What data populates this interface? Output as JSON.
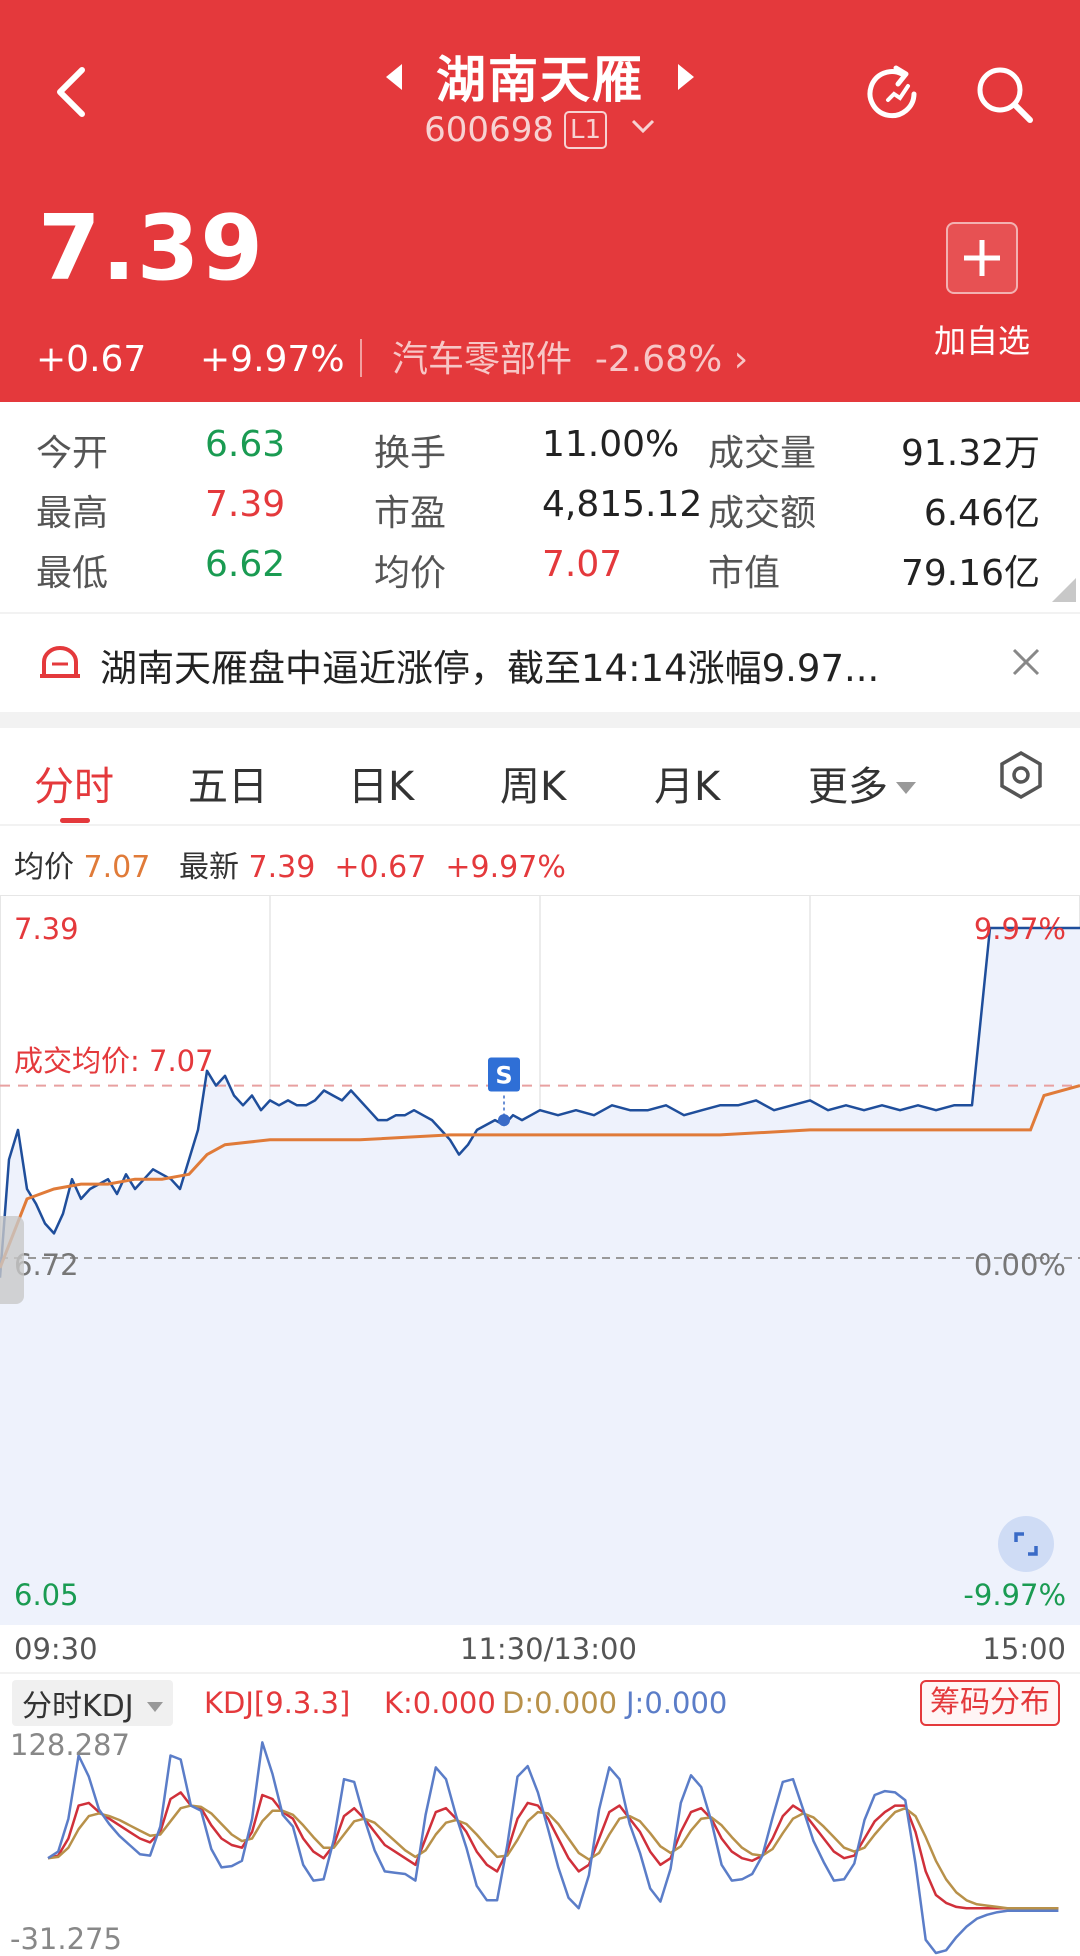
{
  "header": {
    "title": "湖南天雁",
    "code": "600698",
    "level_badge": "L1",
    "price": "7.39",
    "change": "+0.67",
    "change_pct": "+9.97%",
    "sector_name": "汽车零部件",
    "sector_pct": "-2.68%",
    "add_watchlist_label": "加自选",
    "bg_color": "#e4393c"
  },
  "stats": [
    {
      "label": "今开",
      "value": "6.63",
      "color": "green"
    },
    {
      "label": "换手",
      "value": "11.00%",
      "color": "dark"
    },
    {
      "label": "成交量",
      "value": "91.32万",
      "color": "dark"
    },
    {
      "label": "最高",
      "value": "7.39",
      "color": "red"
    },
    {
      "label": "市盈",
      "value": "4,815.12",
      "color": "dark"
    },
    {
      "label": "成交额",
      "value": "6.46亿",
      "color": "dark"
    },
    {
      "label": "最低",
      "value": "6.62",
      "color": "green"
    },
    {
      "label": "均价",
      "value": "7.07",
      "color": "red"
    },
    {
      "label": "市值",
      "value": "79.16亿",
      "color": "dark"
    }
  ],
  "notice": {
    "text": "湖南天雁盘中逼近涨停，截至14:14涨幅9.97..."
  },
  "tabs": {
    "items": [
      "分时",
      "五日",
      "日K",
      "周K",
      "月K",
      "更多"
    ],
    "active": "分时"
  },
  "info_row": {
    "avg_label": "均价",
    "avg_value": "7.07",
    "latest_label": "最新",
    "latest_value": "7.39",
    "change": "+0.67",
    "change_pct": "+9.97%"
  },
  "chart_data": {
    "type": "line",
    "title": "",
    "y_left_ticks": [
      "7.39",
      "6.72",
      "6.05"
    ],
    "y_right_ticks": [
      "9.97%",
      "0.00%",
      "-9.97%"
    ],
    "x_ticks": [
      "09:30",
      "11:30/13:00",
      "15:00"
    ],
    "ylim": [
      6.05,
      7.39
    ],
    "prev_close": 6.72,
    "avg_price_label": "成交均价: 7.07",
    "marker_label": "S",
    "series": [
      {
        "name": "最新",
        "color": "#1f4e9b",
        "x": [
          0,
          2,
          4,
          6,
          8,
          10,
          12,
          14,
          16,
          18,
          20,
          22,
          24,
          26,
          28,
          30,
          32,
          34,
          36,
          38,
          40,
          42,
          44,
          46,
          48,
          50,
          52,
          54,
          56,
          58,
          60,
          62,
          64,
          66,
          68,
          70,
          72,
          74,
          76,
          78,
          80,
          82,
          84,
          86,
          88,
          90,
          92,
          94,
          96,
          98,
          100,
          102,
          104,
          106,
          108,
          110,
          112,
          114,
          116,
          118,
          120,
          124,
          128,
          132,
          136,
          140,
          144,
          148,
          152,
          156,
          160,
          164,
          168,
          172,
          176,
          180,
          184,
          188,
          192,
          196,
          200,
          204,
          208,
          212,
          216,
          220,
          224,
          228,
          232,
          236,
          240
        ],
        "values": [
          6.68,
          6.92,
          6.98,
          6.86,
          6.83,
          6.79,
          6.77,
          6.81,
          6.88,
          6.84,
          6.86,
          6.87,
          6.88,
          6.85,
          6.89,
          6.86,
          6.88,
          6.9,
          6.89,
          6.88,
          6.86,
          6.92,
          6.98,
          7.1,
          7.07,
          7.09,
          7.05,
          7.03,
          7.05,
          7.02,
          7.04,
          7.03,
          7.04,
          7.03,
          7.03,
          7.04,
          7.06,
          7.05,
          7.04,
          7.06,
          7.04,
          7.02,
          7.0,
          7.0,
          7.01,
          7.01,
          7.02,
          7.01,
          7.0,
          6.98,
          6.96,
          6.93,
          6.95,
          6.98,
          6.99,
          7.0,
          6.99,
          7.01,
          7.0,
          7.01,
          7.02,
          7.01,
          7.02,
          7.01,
          7.03,
          7.02,
          7.02,
          7.03,
          7.01,
          7.02,
          7.03,
          7.03,
          7.04,
          7.02,
          7.03,
          7.04,
          7.02,
          7.03,
          7.02,
          7.03,
          7.02,
          7.03,
          7.02,
          7.03,
          7.03,
          7.39,
          7.39,
          7.39,
          7.39,
          7.39,
          7.39
        ]
      },
      {
        "name": "均价",
        "color": "#e07b39",
        "x": [
          0,
          6,
          12,
          18,
          24,
          30,
          36,
          42,
          46,
          50,
          60,
          80,
          100,
          120,
          140,
          160,
          180,
          200,
          220,
          229,
          232,
          240
        ],
        "values": [
          6.7,
          6.84,
          6.86,
          6.87,
          6.87,
          6.88,
          6.88,
          6.89,
          6.93,
          6.95,
          6.96,
          6.96,
          6.97,
          6.97,
          6.97,
          6.97,
          6.98,
          6.98,
          6.98,
          6.98,
          7.05,
          7.07
        ]
      }
    ]
  },
  "kdj": {
    "selector_label": "分时KDJ",
    "params_label": "KDJ[9.3.3]",
    "k_label": "K:0.000",
    "d_label": "D:0.000",
    "j_label": "J:0.000",
    "chip_button_label": "筹码分布",
    "y_top": "128.287",
    "y_bottom": "-31.275",
    "chart_data": {
      "type": "line",
      "ylim": [
        -31.275,
        128.287
      ],
      "series": [
        {
          "name": "K",
          "color": "#d0303a",
          "values": [
            40,
            42,
            55,
            80,
            82,
            75,
            70,
            65,
            60,
            55,
            52,
            60,
            85,
            90,
            80,
            78,
            65,
            55,
            50,
            48,
            60,
            88,
            85,
            75,
            70,
            55,
            45,
            40,
            50,
            72,
            78,
            70,
            60,
            50,
            45,
            40,
            35,
            55,
            75,
            78,
            70,
            60,
            45,
            35,
            30,
            45,
            70,
            82,
            80,
            70,
            55,
            40,
            30,
            35,
            55,
            75,
            80,
            70,
            60,
            45,
            35,
            40,
            60,
            75,
            78,
            70,
            55,
            45,
            40,
            38,
            42,
            55,
            72,
            80,
            75,
            65,
            55,
            45,
            40,
            42,
            55,
            68,
            75,
            80,
            80,
            60,
            30,
            12,
            6,
            3,
            2,
            2,
            2,
            2,
            2,
            2,
            2,
            2,
            2,
            2
          ]
        },
        {
          "name": "D",
          "color": "#b8914a",
          "values": [
            40,
            41,
            48,
            62,
            72,
            74,
            72,
            69,
            65,
            61,
            57,
            58,
            68,
            78,
            80,
            79,
            74,
            66,
            58,
            53,
            55,
            68,
            76,
            76,
            73,
            65,
            56,
            48,
            48,
            58,
            68,
            70,
            67,
            60,
            53,
            46,
            41,
            46,
            58,
            67,
            69,
            66,
            58,
            49,
            41,
            42,
            54,
            68,
            75,
            74,
            66,
            55,
            44,
            39,
            44,
            58,
            70,
            72,
            68,
            59,
            49,
            44,
            49,
            61,
            70,
            71,
            65,
            56,
            48,
            43,
            42,
            47,
            59,
            70,
            74,
            71,
            64,
            56,
            48,
            45,
            48,
            58,
            67,
            75,
            78,
            72,
            56,
            38,
            24,
            14,
            8,
            5,
            4,
            3,
            2,
            2,
            2,
            2,
            2,
            2
          ]
        },
        {
          "name": "J",
          "color": "#5b7dc8",
          "values": [
            40,
            45,
            70,
            118,
            102,
            77,
            66,
            57,
            50,
            43,
            42,
            64,
            118,
            115,
            80,
            76,
            47,
            33,
            34,
            38,
            70,
            128,
            104,
            73,
            64,
            35,
            23,
            24,
            54,
            100,
            98,
            70,
            46,
            30,
            29,
            28,
            23,
            73,
            109,
            100,
            72,
            48,
            19,
            8,
            8,
            50,
            102,
            110,
            90,
            62,
            33,
            10,
            2,
            27,
            77,
            109,
            100,
            66,
            44,
            17,
            7,
            32,
            82,
            103,
            94,
            68,
            35,
            23,
            24,
            28,
            42,
            71,
            98,
            100,
            77,
            53,
            37,
            23,
            24,
            36,
            69,
            88,
            91,
            90,
            84,
            36,
            -22,
            -32,
            -30,
            -20,
            -12,
            -6,
            -3,
            -1,
            0,
            0,
            0,
            0,
            0,
            0
          ]
        }
      ]
    }
  }
}
